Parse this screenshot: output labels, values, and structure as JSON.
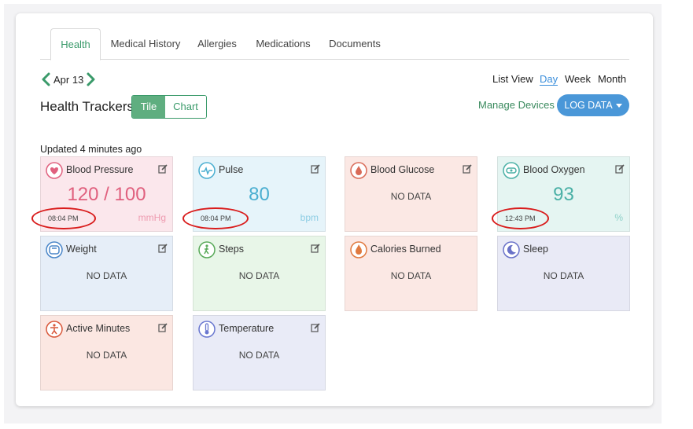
{
  "tabs": [
    "Health",
    "Medical History",
    "Allergies",
    "Medications",
    "Documents"
  ],
  "date": "Apr 13",
  "views": [
    "List View",
    "Day",
    "Week",
    "Month"
  ],
  "title": "Health Trackers",
  "toggle": {
    "tile": "Tile",
    "chart": "Chart"
  },
  "manage_devices": "Manage Devices",
  "log_data": "LOG DATA",
  "updated": "Updated 4 minutes ago",
  "cards": [
    {
      "label": "Blood Pressure",
      "value": "120 / 100",
      "time": "08:04 PM",
      "unit": "mmHg",
      "icon": "heart-icon",
      "color": "#e0607e"
    },
    {
      "label": "Pulse",
      "value": "80",
      "time": "08:04 PM",
      "unit": "bpm",
      "icon": "pulse-icon",
      "color": "#4aaed0"
    },
    {
      "label": "Blood Glucose",
      "value": "NO DATA",
      "icon": "drop-icon",
      "color": "#d96b58"
    },
    {
      "label": "Blood Oxygen",
      "value": "93",
      "time": "12:43 PM",
      "unit": "%",
      "icon": "oxygen-icon",
      "color": "#4ab0a6"
    },
    {
      "label": "Weight",
      "value": "NO DATA",
      "icon": "scale-icon",
      "color": "#4a86c8"
    },
    {
      "label": "Steps",
      "value": "NO DATA",
      "icon": "walk-icon",
      "color": "#5aaa5a"
    },
    {
      "label": "Calories Burned",
      "value": "NO DATA",
      "icon": "flame-icon",
      "color": "#e07a40"
    },
    {
      "label": "Sleep",
      "value": "NO DATA",
      "icon": "moon-icon",
      "color": "#6a72c8"
    },
    {
      "label": "Active Minutes",
      "value": "NO DATA",
      "icon": "active-person-icon",
      "color": "#d9583a"
    },
    {
      "label": "Temperature",
      "value": "NO DATA",
      "icon": "thermometer-icon",
      "color": "#6a78d0"
    }
  ]
}
